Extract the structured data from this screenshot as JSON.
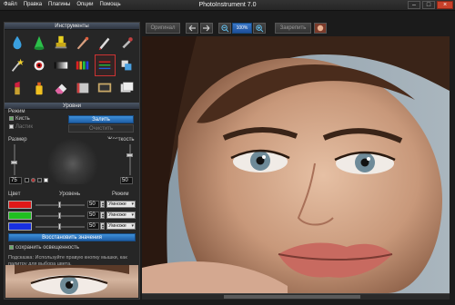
{
  "window": {
    "title": "PhotoInstrument 7.0",
    "menu": [
      "Файл",
      "Правка",
      "Плагины",
      "Опции",
      "Помощь"
    ],
    "controls": [
      "minimize-icon",
      "maximize-icon",
      "close-icon"
    ]
  },
  "tools": {
    "header": "Инструменты",
    "icons": [
      "water-drop-icon",
      "green-cone-icon",
      "yellow-stamp-icon",
      "airbrush-icon",
      "pen-icon",
      "eyedropper-icon",
      "magic-wand-icon",
      "red-eye-icon",
      "gradient-bar-icon",
      "color-levels-icon",
      "sliders-icon",
      "clone-icon",
      "lipstick-icon",
      "yellow-bottle-icon",
      "eraser-icon",
      "book-icon",
      "tv-icon",
      "presets-icon"
    ]
  },
  "levels": {
    "header": "Уровни",
    "mode_label": "Режим",
    "brush_label": "Кисть",
    "eraser_label": "Ластик",
    "apply_label": "Залить",
    "clear_label": "Очистить",
    "size_label": "Размер",
    "hardness_label": "Жесткость",
    "size_value": "75",
    "hardness_value": "50",
    "color_label": "Цвет",
    "level_label": "Уровень",
    "mode_col_label": "Режим",
    "channels": [
      {
        "color": "#e01818",
        "value": "50",
        "mode": "Умноже",
        "level": 0.5
      },
      {
        "color": "#20c020",
        "value": "50",
        "mode": "Умноже",
        "level": 0.5
      },
      {
        "color": "#1830e0",
        "value": "50",
        "mode": "Умноже",
        "level": 0.5
      }
    ],
    "restore_label": "Восстановить значения",
    "preserve_label": "сохранить освещенность",
    "hint": "Подсказка: Используйте правую кнопку мышки, как палитру для выбора цвета."
  },
  "toolbar": {
    "original_label": "Оригинал",
    "zoom_value": "100%",
    "save_label": "Закрепить",
    "icons": [
      "undo-icon",
      "redo-icon",
      "zoom-out-icon",
      "zoom-in-icon",
      "ok-icon"
    ]
  }
}
